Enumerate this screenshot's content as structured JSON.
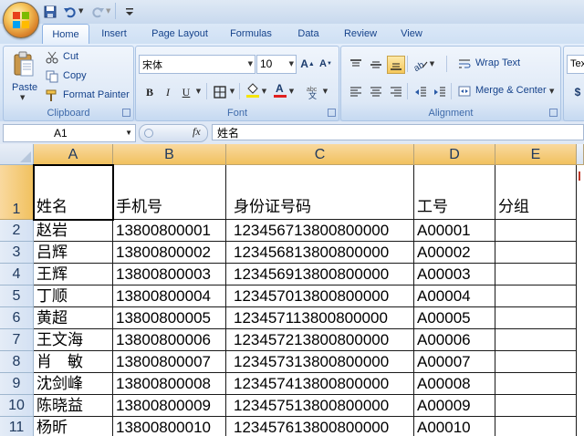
{
  "qat": {
    "icons": [
      "save-icon",
      "undo-icon",
      "redo-icon",
      "customize-icon"
    ]
  },
  "tabs": [
    "Home",
    "Insert",
    "Page Layout",
    "Formulas",
    "Data",
    "Review",
    "View"
  ],
  "active_tab": "Home",
  "clipboard": {
    "paste": "Paste",
    "cut": "Cut",
    "copy": "Copy",
    "format_painter": "Format Painter",
    "label": "Clipboard"
  },
  "font": {
    "name": "宋体",
    "size": "10",
    "bold": "B",
    "italic": "I",
    "underline": "U",
    "label": "Font",
    "font_color": "#e02020",
    "fill_color": "#f5e400"
  },
  "alignment": {
    "wrap_text": "Wrap Text",
    "merge_center": "Merge & Center",
    "label": "Alignment"
  },
  "number_partial": {
    "format_text": "Tex",
    "currency": "$"
  },
  "formula_bar": {
    "name_box": "A1",
    "fx": "fx",
    "content": "姓名"
  },
  "columns": [
    "A",
    "B",
    "C",
    "D",
    "E"
  ],
  "rows": [
    {
      "num": "1",
      "cells": [
        "姓名",
        "手机号",
        "身份证号码",
        "工号",
        "分组"
      ]
    },
    {
      "num": "2",
      "cells": [
        "赵岩",
        "13800800001",
        "123456713800800000",
        "A00001",
        ""
      ]
    },
    {
      "num": "3",
      "cells": [
        "吕辉",
        "13800800002",
        "123456813800800000",
        "A00002",
        ""
      ]
    },
    {
      "num": "4",
      "cells": [
        "王辉",
        "13800800003",
        "123456913800800000",
        "A00003",
        ""
      ]
    },
    {
      "num": "5",
      "cells": [
        "丁顺",
        "13800800004",
        "123457013800800000",
        "A00004",
        ""
      ]
    },
    {
      "num": "6",
      "cells": [
        "黄超",
        "13800800005",
        "123457113800800000",
        "A00005",
        ""
      ]
    },
    {
      "num": "7",
      "cells": [
        "王文海",
        "13800800006",
        "123457213800800000",
        "A00006",
        ""
      ]
    },
    {
      "num": "8",
      "cells": [
        "肖　敏",
        "13800800007",
        "123457313800800000",
        "A00007",
        ""
      ]
    },
    {
      "num": "9",
      "cells": [
        "沈剑峰",
        "13800800008",
        "123457413800800000",
        "A00008",
        ""
      ]
    },
    {
      "num": "10",
      "cells": [
        "陈晓益",
        "13800800009",
        "123457513800800000",
        "A00009",
        ""
      ]
    },
    {
      "num": "11",
      "cells": [
        "杨昕",
        "13800800010",
        "123457613800800000",
        "A00010",
        ""
      ]
    }
  ]
}
